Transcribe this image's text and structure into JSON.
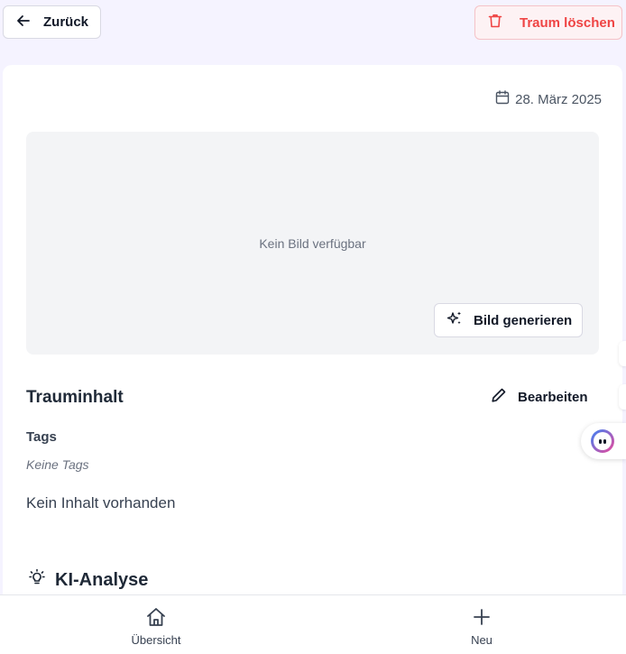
{
  "header": {
    "back_label": "Zurück",
    "delete_label": "Traum löschen"
  },
  "dream": {
    "date": "28. März 2025",
    "image_placeholder": "Kein Bild verfügbar",
    "generate_label": "Bild generieren",
    "content_title": "Trauminhalt",
    "edit_label": "Bearbeiten",
    "tags_label": "Tags",
    "tags_empty": "Keine Tags",
    "content_empty": "Kein Inhalt vorhanden"
  },
  "analysis": {
    "title": "KI-Analyse"
  },
  "nav": {
    "items": [
      {
        "label": "Übersicht",
        "icon": "home-icon"
      },
      {
        "label": "Neu",
        "icon": "plus-icon"
      }
    ]
  },
  "colors": {
    "background": "#f5f3ff",
    "danger": "#ef4444",
    "danger_bg": "#fdf2f4"
  }
}
